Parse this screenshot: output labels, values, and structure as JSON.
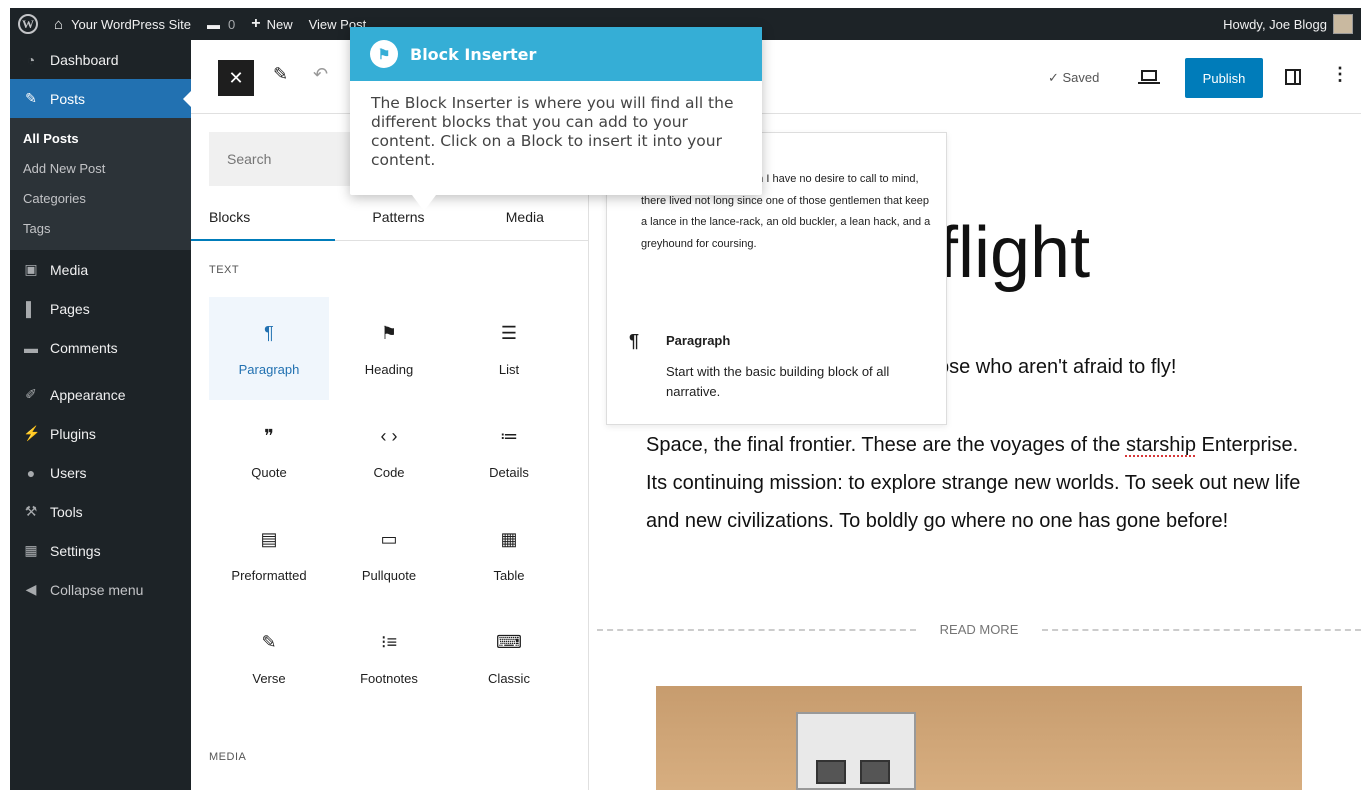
{
  "admin_bar": {
    "site_name": "Your WordPress Site",
    "comments_count": "0",
    "new_label": "New",
    "view_post_label": "View Post",
    "howdy": "Howdy, Joe Blogg"
  },
  "admin_menu": {
    "items": [
      {
        "label": "Dashboard",
        "icon": "dashboard-icon"
      },
      {
        "label": "Posts",
        "icon": "pin-icon"
      },
      {
        "label": "Media",
        "icon": "media-icon"
      },
      {
        "label": "Pages",
        "icon": "pages-icon"
      },
      {
        "label": "Comments",
        "icon": "comments-icon"
      },
      {
        "label": "Appearance",
        "icon": "appearance-icon"
      },
      {
        "label": "Plugins",
        "icon": "plugins-icon"
      },
      {
        "label": "Users",
        "icon": "users-icon"
      },
      {
        "label": "Tools",
        "icon": "tools-icon"
      },
      {
        "label": "Settings",
        "icon": "settings-icon"
      },
      {
        "label": "Collapse menu",
        "icon": "collapse-icon"
      }
    ],
    "submenu": [
      "All Posts",
      "Add New Post",
      "Categories",
      "Tags"
    ]
  },
  "header": {
    "saved_label": "✓ Saved",
    "publish_label": "Publish"
  },
  "inserter": {
    "search_placeholder": "Search",
    "tabs": [
      "Blocks",
      "Patterns",
      "Media"
    ],
    "category_text": "TEXT",
    "category_media": "MEDIA",
    "blocks": [
      {
        "label": "Paragraph",
        "icon": "¶"
      },
      {
        "label": "Heading",
        "icon": "⚑"
      },
      {
        "label": "List",
        "icon": "☰"
      },
      {
        "label": "Quote",
        "icon": "❞"
      },
      {
        "label": "Code",
        "icon": "‹ ›"
      },
      {
        "label": "Details",
        "icon": "≔"
      },
      {
        "label": "Preformatted",
        "icon": "▤"
      },
      {
        "label": "Pullquote",
        "icon": "▭"
      },
      {
        "label": "Table",
        "icon": "▦"
      },
      {
        "label": "Verse",
        "icon": "✎"
      },
      {
        "label": "Footnotes",
        "icon": "⁝≡"
      },
      {
        "label": "Classic",
        "icon": "⌨"
      }
    ]
  },
  "tooltip": {
    "title": "Block Inserter",
    "body": "The Block Inserter is where you will find all the different blocks that you can add to your content. Click on a Block to insert it into your content."
  },
  "preview": {
    "sample_text": "...cha, the name of which I have no desire to call to mind, there lived not long since one of those gentlemen that keep a lance in the lance-rack, an old buckler, a lean hack, and a greyhound for coursing.",
    "block_name": "Paragraph",
    "block_description": "Start with the basic building block of all narrative."
  },
  "canvas": {
    "title_fragment": "flight",
    "subtitle_fragment": "ose who aren't afraid to fly!",
    "body_before": "Space, the final frontier. These are the voyages of the ",
    "body_underlined": "starship",
    "body_after": " Enterprise. Its continuing mission: to explore strange new worlds. To seek out new life and new civilizations. To boldly go where no one has gone before!",
    "read_more": "READ MORE"
  }
}
